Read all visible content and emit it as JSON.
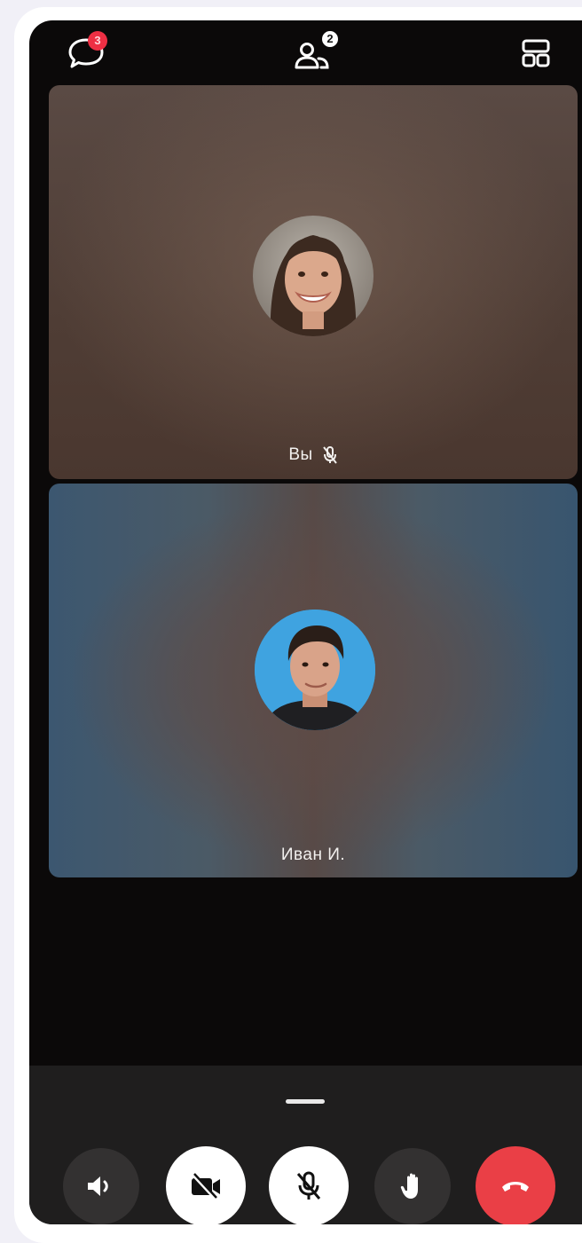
{
  "topbar": {
    "chat_badge": "3",
    "participants_badge": "2"
  },
  "tiles": [
    {
      "label": "Вы",
      "mic_muted": true
    },
    {
      "label": "Иван И."
    }
  ],
  "controls": {
    "items": [
      {
        "name": "speaker",
        "icon": "speaker-icon"
      },
      {
        "name": "camera-off",
        "icon": "camera-off-icon"
      },
      {
        "name": "mic-off",
        "icon": "mic-off-icon"
      },
      {
        "name": "raise-hand",
        "icon": "hand-icon"
      },
      {
        "name": "end-call",
        "icon": "phone-hangup-icon"
      }
    ]
  },
  "colors": {
    "background": "#0b0909",
    "badge_red": "#ee2f44",
    "end_call_red": "#ea3f46",
    "control_dark": "#333131",
    "control_white": "#ffffff"
  }
}
